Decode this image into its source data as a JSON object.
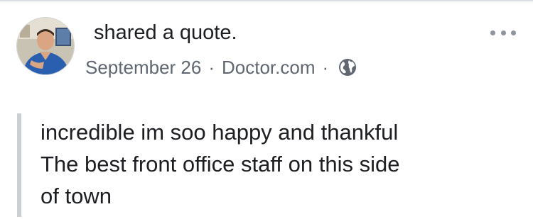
{
  "post": {
    "action_text": "shared a quote.",
    "date": "September 26",
    "separator": "·",
    "source": "Doctor.com",
    "privacy_icon": "globe-icon",
    "more_icon": "more-options-icon",
    "quote_lines": [
      "incredible im soo happy and thankful",
      "The best front office staff on this side",
      "of town"
    ]
  },
  "colors": {
    "primary_text": "#1c1e21",
    "secondary_text": "#606770",
    "quote_bar": "#ccd0d5",
    "avatar_scrub": "#2a5fb0"
  }
}
